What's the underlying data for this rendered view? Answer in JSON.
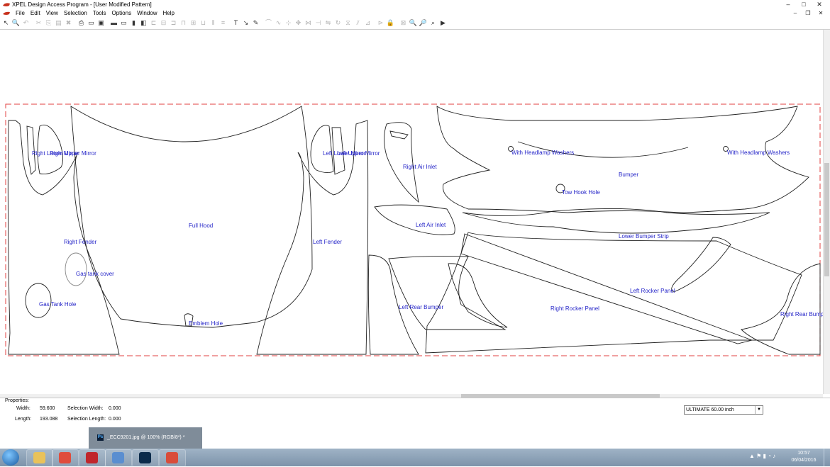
{
  "window": {
    "title": "XPEL Design Access Program - [User Modified Pattern]",
    "min": "–",
    "max": "□",
    "close": "✕"
  },
  "menu": [
    "File",
    "Edit",
    "View",
    "Selection",
    "Tools",
    "Options",
    "Window",
    "Help"
  ],
  "mdi_controls": {
    "min": "–",
    "restore": "❐",
    "close": "✕"
  },
  "toolbar": {
    "icons": [
      {
        "name": "pointer-icon",
        "glyph": "↖",
        "enabled": true
      },
      {
        "name": "zoom-select-icon",
        "glyph": "🔍",
        "enabled": true
      },
      {
        "name": "undo-icon",
        "glyph": "↶",
        "enabled": false
      },
      {
        "name": "cut-icon",
        "glyph": "✂",
        "enabled": false
      },
      {
        "name": "copy-icon",
        "glyph": "⎘",
        "enabled": false
      },
      {
        "name": "paste-icon",
        "glyph": "▤",
        "enabled": false
      },
      {
        "name": "delete-icon",
        "glyph": "✖",
        "enabled": false
      },
      {
        "name": "print-icon",
        "glyph": "⎙",
        "enabled": true
      },
      {
        "name": "print-preview-icon",
        "glyph": "▭",
        "enabled": true
      },
      {
        "name": "plotter-icon",
        "glyph": "▣",
        "enabled": true
      },
      {
        "name": "line-icon",
        "glyph": "▬",
        "enabled": true
      },
      {
        "name": "ruler-icon",
        "glyph": "▭",
        "enabled": true
      },
      {
        "name": "book-icon",
        "glyph": "▮",
        "enabled": true
      },
      {
        "name": "layers-icon",
        "glyph": "◧",
        "enabled": true
      },
      {
        "name": "align-left-icon",
        "glyph": "⊏",
        "enabled": false
      },
      {
        "name": "align-center-icon",
        "glyph": "⊟",
        "enabled": false
      },
      {
        "name": "align-right-icon",
        "glyph": "⊐",
        "enabled": false
      },
      {
        "name": "align-top-icon",
        "glyph": "⊓",
        "enabled": false
      },
      {
        "name": "align-middle-icon",
        "glyph": "⊞",
        "enabled": false
      },
      {
        "name": "align-bottom-icon",
        "glyph": "⊔",
        "enabled": false
      },
      {
        "name": "distribute-h-icon",
        "glyph": "⫴",
        "enabled": false
      },
      {
        "name": "distribute-v-icon",
        "glyph": "≡",
        "enabled": false
      },
      {
        "name": "text-icon",
        "glyph": "T",
        "enabled": true
      },
      {
        "name": "edit-node-icon",
        "glyph": "↘",
        "enabled": true
      },
      {
        "name": "pen-icon",
        "glyph": "✎",
        "enabled": true
      },
      {
        "name": "bezier-icon",
        "glyph": "⌒",
        "enabled": false
      },
      {
        "name": "curve-icon",
        "glyph": "∿",
        "enabled": false
      },
      {
        "name": "node-icon",
        "glyph": "⊹",
        "enabled": false
      },
      {
        "name": "move-icon",
        "glyph": "✥",
        "enabled": false
      },
      {
        "name": "break-icon",
        "glyph": "⋈",
        "enabled": false
      },
      {
        "name": "join-icon",
        "glyph": "⊣",
        "enabled": false
      },
      {
        "name": "flip-icon",
        "glyph": "⇋",
        "enabled": false
      },
      {
        "name": "rotate-icon",
        "glyph": "↻",
        "enabled": false
      },
      {
        "name": "mirror-icon",
        "glyph": "⧖",
        "enabled": false
      },
      {
        "name": "shear-icon",
        "glyph": "⫽",
        "enabled": false
      },
      {
        "name": "trim-icon",
        "glyph": "⊿",
        "enabled": false
      },
      {
        "name": "extend-icon",
        "glyph": "⊳",
        "enabled": false
      },
      {
        "name": "lock-icon",
        "glyph": "🔒",
        "enabled": false
      },
      {
        "name": "group-icon",
        "glyph": "⊠",
        "enabled": false
      },
      {
        "name": "zoom-in-icon",
        "glyph": "🔍",
        "enabled": true
      },
      {
        "name": "zoom-out-icon",
        "glyph": "🔎",
        "enabled": true
      },
      {
        "name": "zoom-fit-icon",
        "glyph": "⌕",
        "enabled": true
      },
      {
        "name": "cut-plot-icon",
        "glyph": "▶",
        "enabled": true
      }
    ]
  },
  "pattern_labels": [
    "Right Lower Mirror",
    "Right Upper Mirror",
    "Full Hood",
    "Right Fender",
    "Gas tank cover",
    "Gas Tank Hole",
    "Emblem Hole",
    "Left Lower Mirror",
    "Left Upper Mirror",
    "Left Fender",
    "Right Air Inlet",
    "With Headlamp Washers",
    "With Headlamp Washers",
    "Bumper",
    "Tow Hook Hole",
    "Left Air Inlet",
    "Lower Bumper Strip",
    "Left Rocker Panel",
    "Left Rear Bumper",
    "Right Rocker Panel",
    "Right Rear Bump"
  ],
  "properties": {
    "header": "Properties:",
    "width_label": "Width:",
    "width_value": "59.600",
    "length_label": "Length:",
    "length_value": "193.088",
    "sel_width_label": "Selection Width:",
    "sel_width_value": "0.000",
    "sel_length_label": "Selection Length:",
    "sel_length_value": "0.000",
    "material": "ULTIMATE  60.00 inch",
    "dropdown_arrow": "▼"
  },
  "ps_window": {
    "icon": "Ps",
    "title": "_ECC9201.jpg @ 100% (RGB/8*) *"
  },
  "taskbar": {
    "apps": [
      {
        "name": "explorer",
        "color": "#e9c25a"
      },
      {
        "name": "chrome",
        "color": "#e04c3c"
      },
      {
        "name": "creative-cloud",
        "color": "#c0262c"
      },
      {
        "name": "image-viewer",
        "color": "#5a8ed0"
      },
      {
        "name": "photoshop",
        "color": "#0b2a4a"
      },
      {
        "name": "xpel-dap",
        "color": "#d94c3a"
      }
    ],
    "tray_icons": "▲ ⚑ ▮ ◔ ♪",
    "time": "10:57",
    "date": "06/04/2016"
  }
}
